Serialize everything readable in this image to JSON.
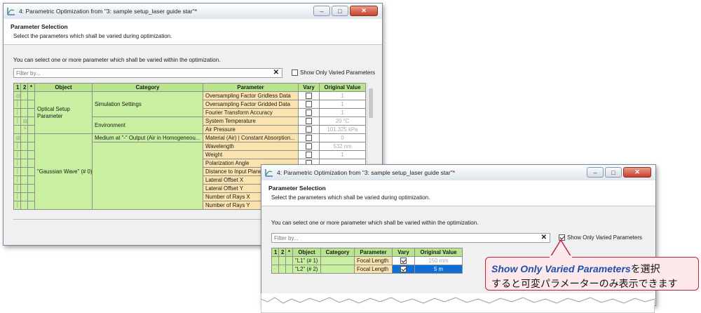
{
  "window1": {
    "title": "4: Parametric Optimization from \"3: sample setup_laser guide star\"*",
    "header_title": "Parameter Selection",
    "header_subtitle": "Select the parameters which shall be varied during optimization.",
    "info": "You can select one or more parameter which shall be varied within the optimization.",
    "filter_placeholder": "Filter by...",
    "show_only_label": "Show Only Varied Parameters",
    "columns": [
      "1",
      "2",
      "*",
      "Object",
      "Category",
      "Parameter",
      "Vary",
      "Original Value"
    ],
    "objects": {
      "optical_setup": "Optical Setup Parameter",
      "gaussian_wave": "\"Gaussian Wave\" (# 0)"
    },
    "categories": {
      "simulation": "Simulation Settings",
      "environment": "Environment",
      "medium": "Medium at \"-\" Output (Air in Homogeneou..."
    },
    "rows": [
      {
        "parameter": "Oversampling Factor Gridless Data",
        "value": "1"
      },
      {
        "parameter": "Oversampling Factor Gridded Data",
        "value": "1"
      },
      {
        "parameter": "Fourier Transform Accuracy",
        "value": "1"
      },
      {
        "parameter": "System Temperature",
        "value": "20 °C"
      },
      {
        "parameter": "Air Pressure",
        "value": "101.325 kPa"
      },
      {
        "parameter": "Material (Air) | Constant Absorption...",
        "value": "0"
      },
      {
        "parameter": "Wavelength",
        "value": "532 nm"
      },
      {
        "parameter": "Weight",
        "value": "1"
      },
      {
        "parameter": "Polarization Angle",
        "value": ""
      },
      {
        "parameter": "Distance to Input Plane",
        "value": ""
      },
      {
        "parameter": "Lateral Offset X",
        "value": ""
      },
      {
        "parameter": "Lateral Offset Y",
        "value": ""
      },
      {
        "parameter": "Number of Rays X",
        "value": ""
      },
      {
        "parameter": "Number of Rays Y",
        "value": ""
      }
    ]
  },
  "window2": {
    "title": "4: Parametric Optimization from \"3: sample setup_laser guide star\"*",
    "header_title": "Parameter Selection",
    "header_subtitle": "Select the parameters which shall be varied during optimization.",
    "info": "You can select one or more parameter which shall be varied within the optimization.",
    "filter_placeholder": "Filter by...",
    "show_only_label": "Show Only Varied Parameters",
    "columns": [
      "1",
      "2",
      "*",
      "Object",
      "Category",
      "Parameter",
      "Vary",
      "Original Value"
    ],
    "rows": [
      {
        "object": "\"L1\" (# 1)",
        "category": "",
        "parameter": "Focal Length",
        "value": "150 mm"
      },
      {
        "object": "\"L2\" (# 2)",
        "category": "",
        "parameter": "Focal Length",
        "value": "5 m"
      }
    ]
  },
  "callout": {
    "highlight": "Show Only Varied Parameters",
    "line1_suffix": "を選択",
    "line2": "すると可変パラメーターのみ表示できます"
  },
  "colors": {
    "header_green": "#b7e48d",
    "object_green": "#c8f0a0",
    "parameter_orange": "#fbe3b0",
    "selection_blue": "#0f6fd6",
    "callout_border": "#c0203a",
    "callout_fill": "#fde8ec",
    "callout_highlight": "#1f4fa8"
  }
}
